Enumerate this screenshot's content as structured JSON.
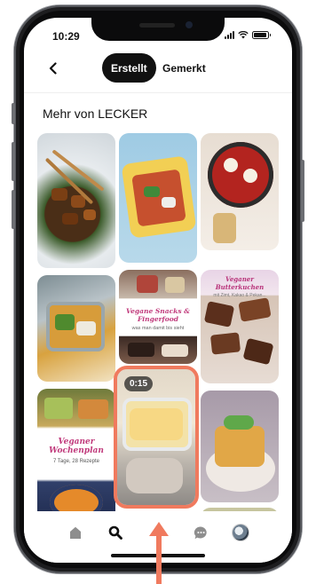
{
  "status_bar": {
    "time": "10:29",
    "battery_level": 0.9
  },
  "header": {
    "back_icon": "chevron-left-icon",
    "tabs": [
      {
        "label": "Erstellt",
        "active": true
      },
      {
        "label": "Gemerkt",
        "active": false
      }
    ]
  },
  "section": {
    "title": "Mehr von LECKER"
  },
  "pins": {
    "snacks_title": "Vegane Snacks & Fingerfood",
    "snacks_subtitle": "was man damit bis sieht",
    "bark_title": "Veganer Butterkuchen",
    "bark_subtitle": "mit Zimt, Kakao & Pekan...",
    "week_title": "Veganer Wochenplan",
    "week_subtitle": "7 Tage, 28 Rezepte",
    "video_duration": "0:15"
  },
  "bottom_nav": {
    "items": [
      "home-icon",
      "search-icon",
      "chat-icon",
      "profile-avatar"
    ],
    "active": "search-icon"
  },
  "colors": {
    "accent": "#f07a5e",
    "brand_pink": "#c0397b",
    "active_tab": "#111111"
  }
}
